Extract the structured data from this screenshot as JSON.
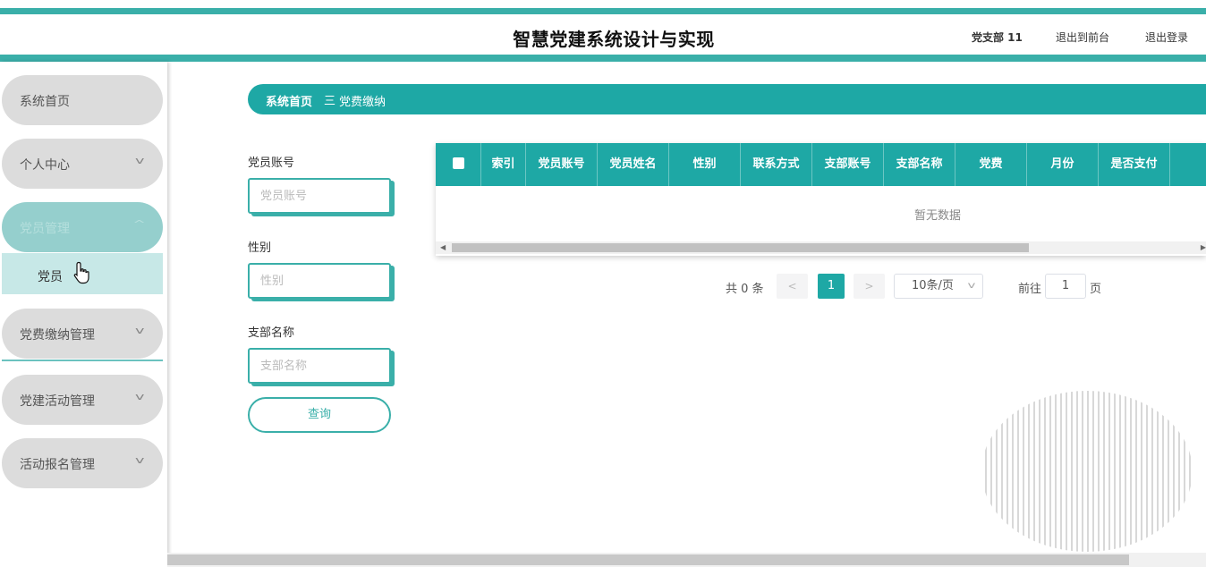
{
  "header": {
    "title": "智慧党建系统设计与实现",
    "user": "党支部 11",
    "link_frontend": "退出到前台",
    "link_logout": "退出登录"
  },
  "sidebar": {
    "items": [
      {
        "label": "系统首页"
      },
      {
        "label": "个人中心"
      },
      {
        "label": "党员管理"
      },
      {
        "label": "党费缴纳管理"
      },
      {
        "label": "党建活动管理"
      },
      {
        "label": "活动报名管理"
      }
    ],
    "submenu": {
      "label": "党员"
    }
  },
  "breadcrumb": {
    "home": "系统首页",
    "separator": "三",
    "current": "党费缴纳"
  },
  "filters": {
    "account_label": "党员账号",
    "account_placeholder": "党员账号",
    "gender_label": "性别",
    "gender_placeholder": "性别",
    "branch_label": "支部名称",
    "branch_placeholder": "支部名称",
    "query_button": "查询"
  },
  "table": {
    "columns": [
      "索引",
      "党员账号",
      "党员姓名",
      "性别",
      "联系方式",
      "支部账号",
      "支部名称",
      "党费",
      "月份",
      "是否支付"
    ],
    "empty_text": "暂无数据"
  },
  "pagination": {
    "total": "共 0 条",
    "prev": "<",
    "current": "1",
    "next": ">",
    "page_size": "10条/页",
    "goto_label": "前往",
    "goto_value": "1",
    "page_suffix": "页"
  },
  "colors": {
    "accent": "#1ea8a5",
    "accent_light": "#3aafa9",
    "menu_bg": "#dcdcdc"
  }
}
